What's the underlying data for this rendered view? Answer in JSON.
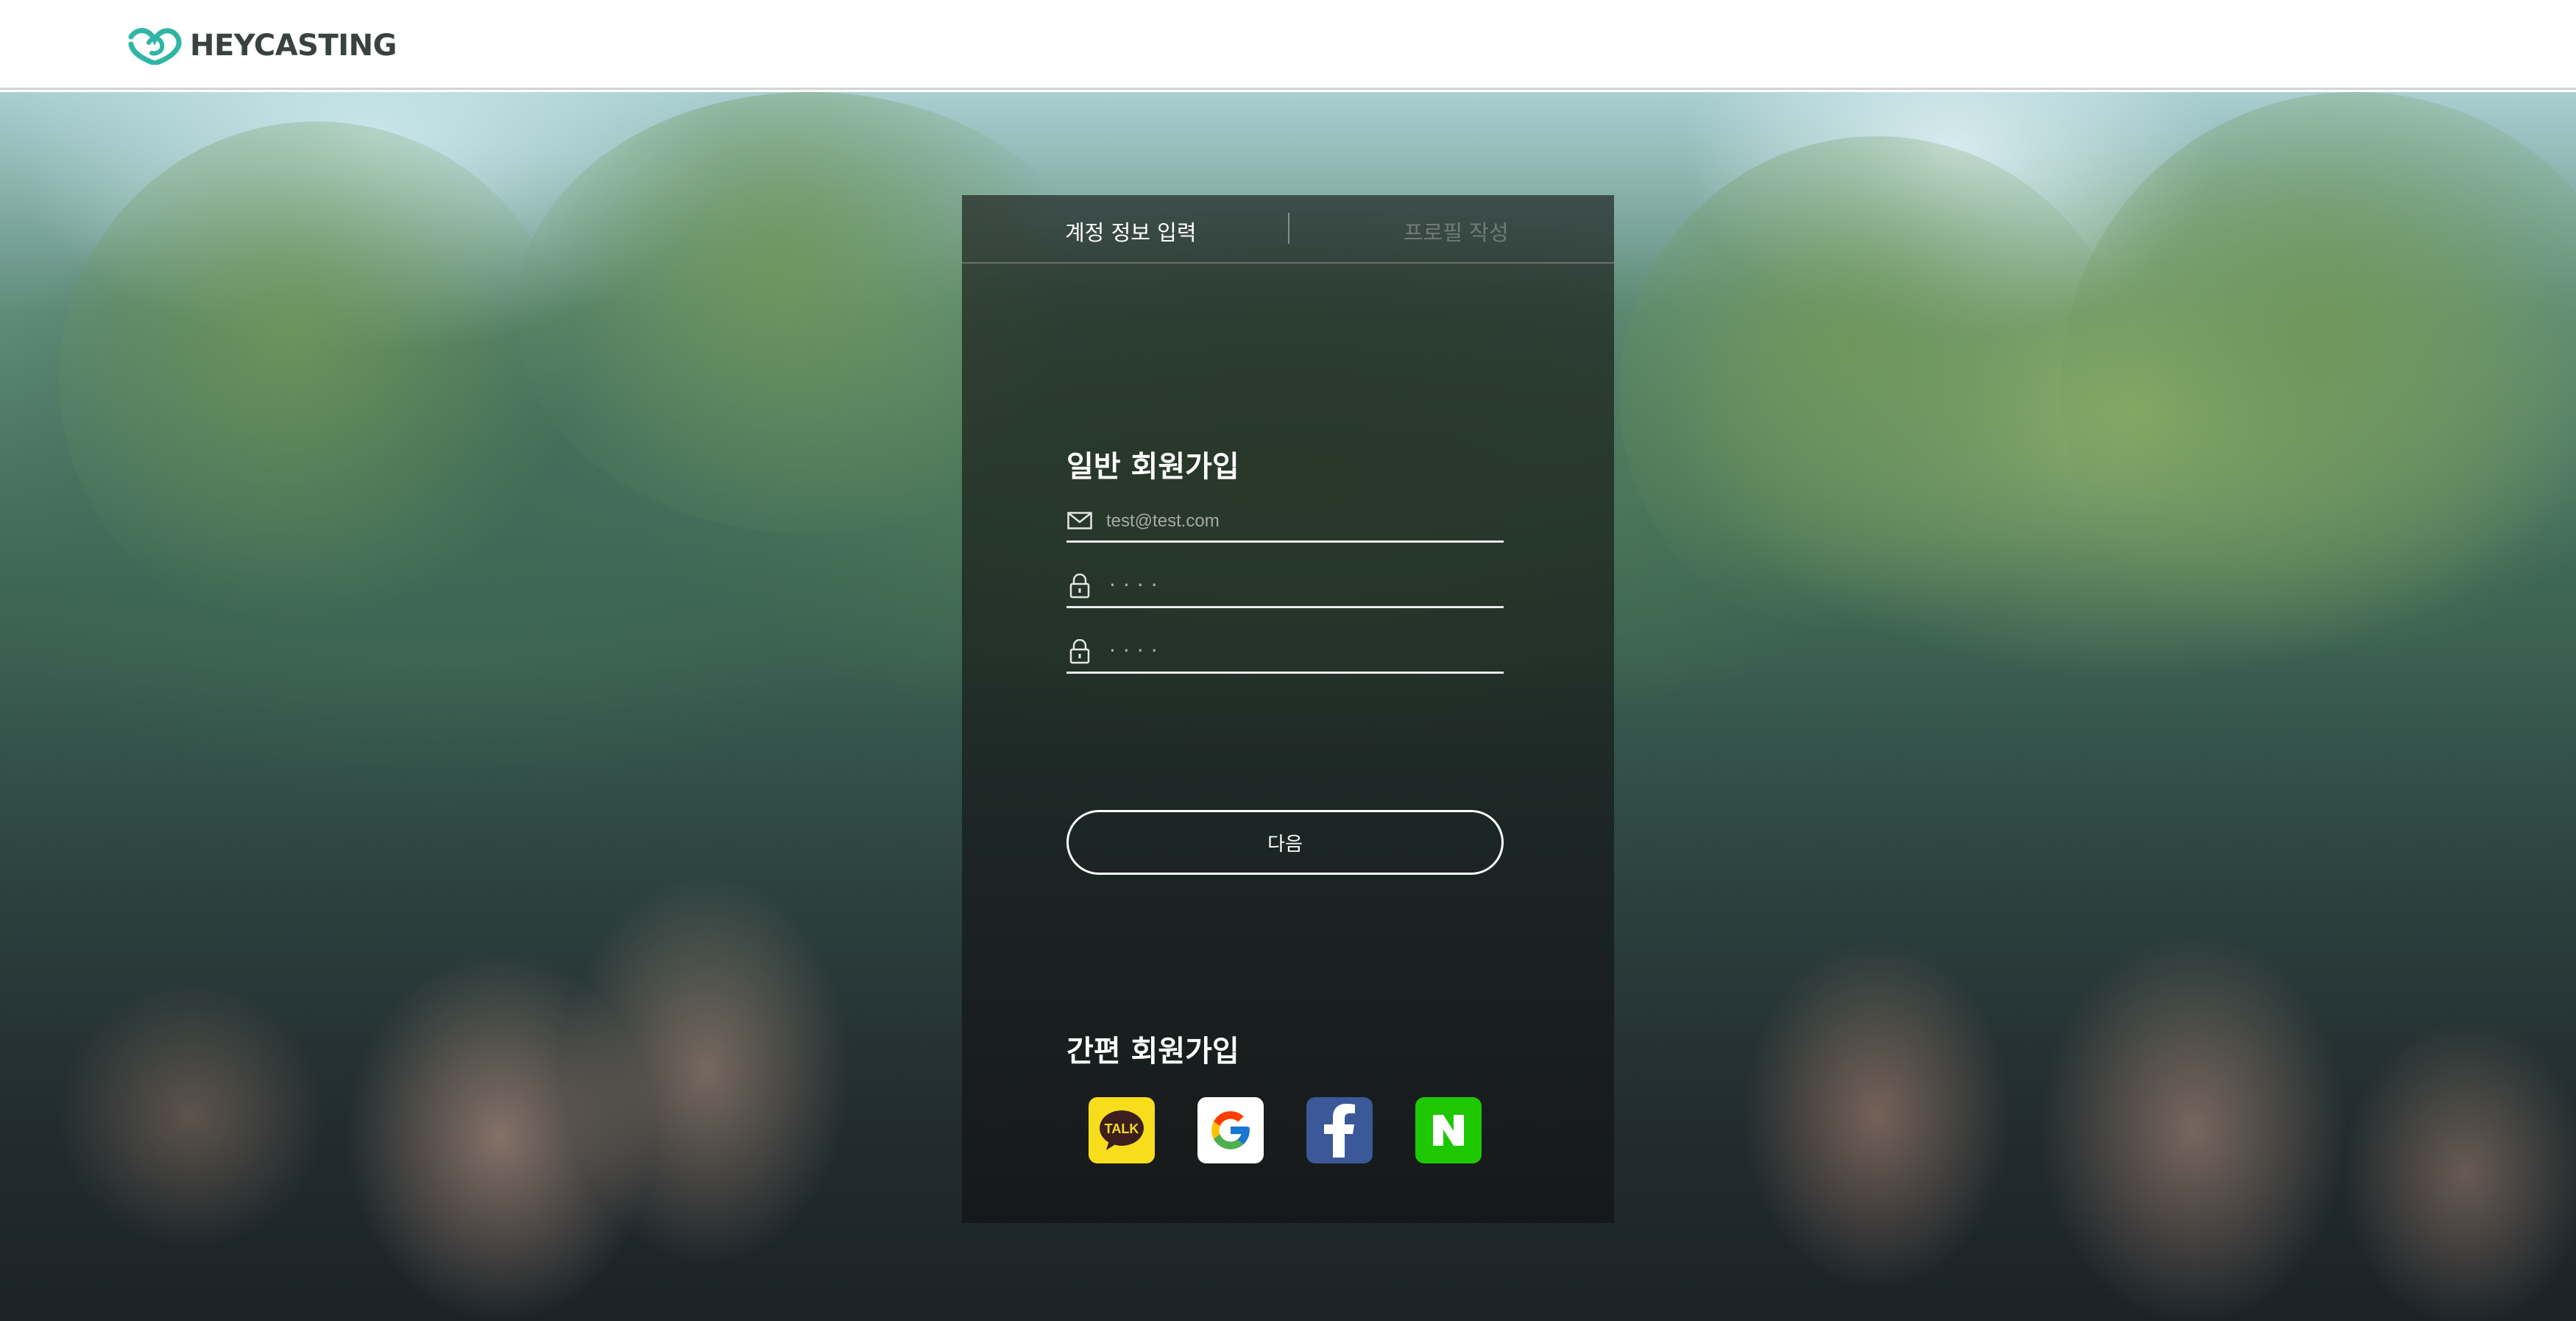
{
  "header": {
    "logo_text": "HEYCASTING",
    "logo_icon": "heart-logo-icon",
    "brand_color": "#2fb5a5"
  },
  "steps": [
    {
      "label": "계정 정보 입력",
      "state": "active"
    },
    {
      "label": "프로필 작성",
      "state": "inactive"
    }
  ],
  "signup": {
    "general_title": "일반 회원가입",
    "email_placeholder": "test@test.com",
    "email_icon": "mail-icon",
    "password_placeholder": "····",
    "password_confirm_placeholder": "····",
    "password_icon": "lock-icon",
    "next_label": "다음"
  },
  "social": {
    "title": "간편 회원가입",
    "buttons": [
      {
        "name": "kakao",
        "icon": "kakao-talk-icon",
        "color": "#f7dd1c",
        "text": "TALK"
      },
      {
        "name": "google",
        "icon": "google-icon",
        "color": "#ffffff"
      },
      {
        "name": "facebook",
        "icon": "facebook-icon",
        "color": "#3b5998"
      },
      {
        "name": "naver",
        "icon": "naver-icon",
        "color": "#1ec800"
      }
    ]
  }
}
